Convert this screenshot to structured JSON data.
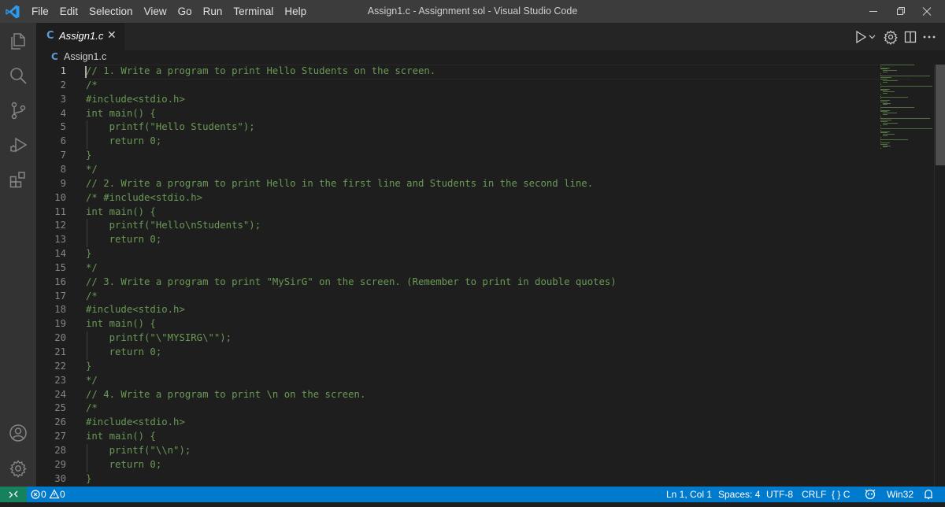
{
  "window": {
    "title": "Assign1.c - Assignment sol - Visual Studio Code",
    "menu": [
      "File",
      "Edit",
      "Selection",
      "View",
      "Go",
      "Run",
      "Terminal",
      "Help"
    ],
    "controls": [
      "minimize-icon",
      "restore-icon",
      "close-icon"
    ]
  },
  "activity_bar": [
    "explorer-icon",
    "search-icon",
    "source-control-icon",
    "run-debug-icon",
    "extensions-icon",
    "accounts-icon",
    "manage-gear-icon"
  ],
  "tab": {
    "icon_label": "C",
    "label": "Assign1.c",
    "close": "✕"
  },
  "breadcrumb": {
    "icon_label": "C",
    "label": "Assign1.c"
  },
  "editor": {
    "active_line": 1,
    "lines": [
      {
        "n": "1",
        "text": "// 1. Write a program to print Hello Students on the screen."
      },
      {
        "n": "2",
        "text": "/*"
      },
      {
        "n": "3",
        "text": "#include<stdio.h>"
      },
      {
        "n": "4",
        "text": "int main() {"
      },
      {
        "n": "5",
        "text": "    printf(\"Hello Students\");"
      },
      {
        "n": "6",
        "text": "    return 0;"
      },
      {
        "n": "7",
        "text": "}"
      },
      {
        "n": "8",
        "text": "*/"
      },
      {
        "n": "9",
        "text": "// 2. Write a program to print Hello in the first line and Students in the second line."
      },
      {
        "n": "10",
        "text": "/* #include<stdio.h>"
      },
      {
        "n": "11",
        "text": "int main() {"
      },
      {
        "n": "12",
        "text": "    printf(\"Hello\\nStudents\");"
      },
      {
        "n": "13",
        "text": "    return 0;"
      },
      {
        "n": "14",
        "text": "}"
      },
      {
        "n": "15",
        "text": "*/"
      },
      {
        "n": "16",
        "text": "// 3. Write a program to print \"MySirG\" on the screen. (Remember to print in double quotes)"
      },
      {
        "n": "17",
        "text": "/*"
      },
      {
        "n": "18",
        "text": "#include<stdio.h>"
      },
      {
        "n": "19",
        "text": "int main() {"
      },
      {
        "n": "20",
        "text": "    printf(\"\\\"MYSIRG\\\"\");"
      },
      {
        "n": "21",
        "text": "    return 0;"
      },
      {
        "n": "22",
        "text": "}"
      },
      {
        "n": "23",
        "text": "*/"
      },
      {
        "n": "24",
        "text": "// 4. Write a program to print \\n on the screen."
      },
      {
        "n": "25",
        "text": "/*"
      },
      {
        "n": "26",
        "text": "#include<stdio.h>"
      },
      {
        "n": "27",
        "text": "int main() {"
      },
      {
        "n": "28",
        "text": "    printf(\"\\\\n\");"
      },
      {
        "n": "29",
        "text": "    return 0;"
      },
      {
        "n": "30",
        "text": "}"
      }
    ]
  },
  "status_bar": {
    "errors": "0",
    "warnings": "0",
    "position": "Ln 1, Col 1",
    "spaces": "Spaces: 4",
    "encoding": "UTF-8",
    "eol": "CRLF",
    "language": "C",
    "platform": "Win32"
  },
  "colors": {
    "comment": "#6a9955",
    "status_bar": "#007acc",
    "remote": "#16825d",
    "title_bar": "#3c3c3c",
    "activity_bar": "#333333",
    "editor_bg": "#1e1e1e"
  }
}
